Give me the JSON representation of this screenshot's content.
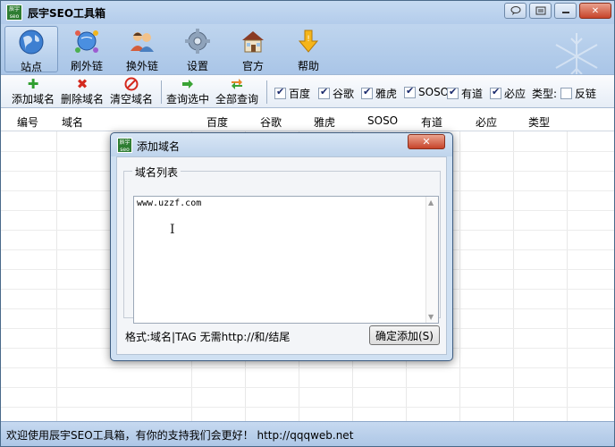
{
  "app": {
    "title": "辰宇SEO工具箱",
    "logo_text": "辰宇 seo"
  },
  "window_buttons": {
    "close": "✕"
  },
  "main_toolbar": [
    {
      "label": "站点",
      "icon": "globe-icon",
      "active": true
    },
    {
      "label": "刷外链",
      "icon": "network-globe-icon",
      "active": false
    },
    {
      "label": "换外链",
      "icon": "users-icon",
      "active": false
    },
    {
      "label": "设置",
      "icon": "gear-icon",
      "active": false
    },
    {
      "label": "官方",
      "icon": "house-icon",
      "active": false
    },
    {
      "label": "帮助",
      "icon": "help-arrow-icon",
      "active": false
    }
  ],
  "sub_toolbar": {
    "add_domain": "添加域名",
    "delete_domain": "删除域名",
    "clear_domain": "清空域名",
    "query_selected": "查询选中",
    "query_all": "全部查询",
    "checkboxes": [
      {
        "label": "百度",
        "checked": true
      },
      {
        "label": "谷歌",
        "checked": true
      },
      {
        "label": "雅虎",
        "checked": true
      },
      {
        "label": "SOSO",
        "checked": true
      },
      {
        "label": "有道",
        "checked": true
      },
      {
        "label": "必应",
        "checked": true
      }
    ],
    "type_label": "类型:",
    "reverse_link": {
      "label": "反链",
      "checked": false
    }
  },
  "grid": {
    "columns": [
      "编号",
      "域名",
      "百度",
      "谷歌",
      "雅虎",
      "SOSO",
      "有道",
      "必应",
      "类型"
    ]
  },
  "status_bar": {
    "text": "欢迎使用辰宇SEO工具箱，有你的支持我们会更好！ http://qqqweb.net"
  },
  "dialog": {
    "title": "添加域名",
    "logo_text": "辰宇 seo",
    "close": "✕",
    "group_label": "域名列表",
    "textarea_value": "www.uzzf.com",
    "format_hint": "格式:域名|TAG  无需http://和/结尾",
    "confirm_button": "确定添加(S)"
  },
  "colors": {
    "window_bg": "#b9d1ea",
    "close_red": "#c7432a",
    "logo_green": "#2e7d32"
  }
}
